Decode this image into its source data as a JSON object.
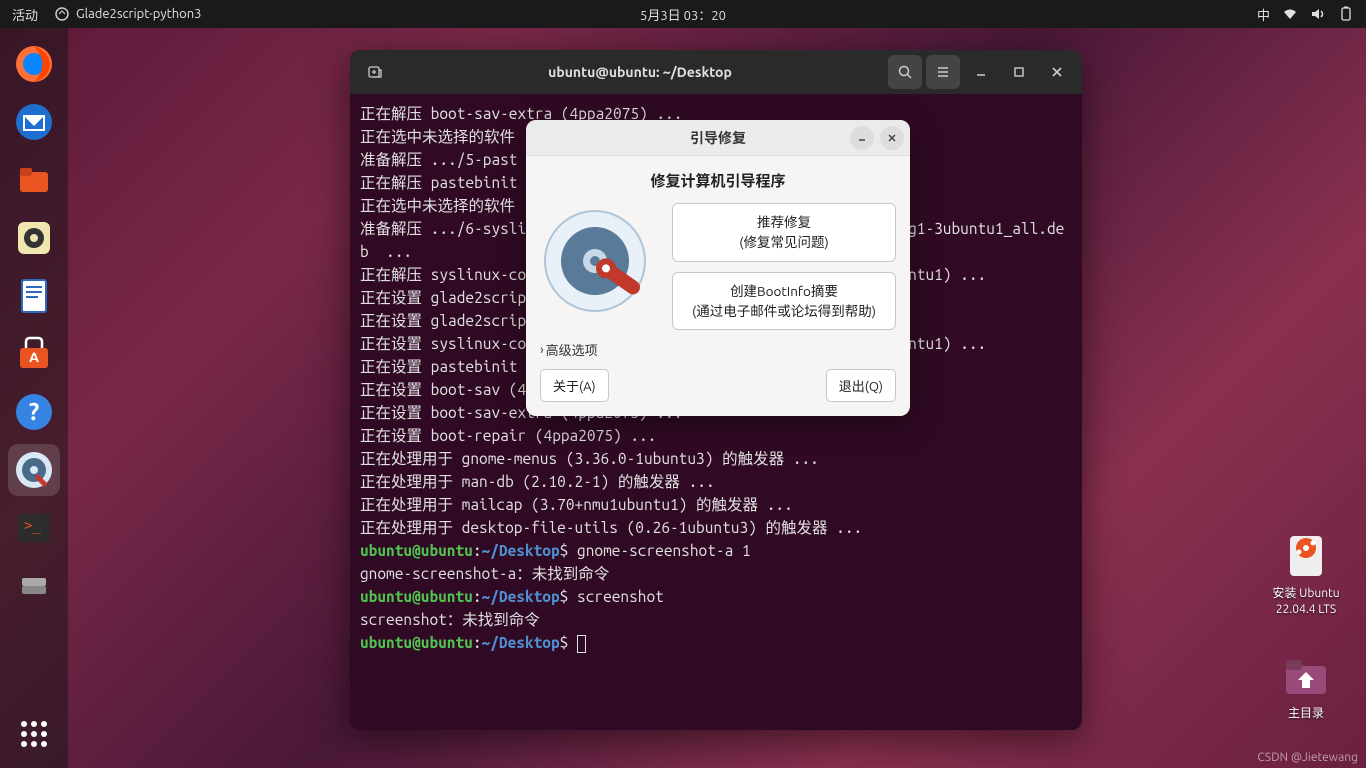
{
  "topbar": {
    "activities": "活动",
    "app_name": "Glade2script-python3",
    "datetime": "5月3日 03：20",
    "input_method": "中"
  },
  "terminal": {
    "title": "ubuntu@ubuntu: ~/Desktop",
    "lines": [
      "正在解压 boot-sav-extra (4ppa2075) ...",
      "正在选中未选择的软件",
      "准备解压 .../5-past",
      "正在解压 pastebinit",
      "正在选中未选择的软件",
      "准备解压 .../6-syslinux-common_3%3a6.04~git20190206.bf6db5b4+dfsg1-3ubuntu1_all.deb  ...",
      "正在解压 syslinux-common (3:6.04~git20190206.bf6db5b4+dfsg1-3ubuntu1) ...",
      "正在设置 glade2script",
      "正在设置 glade2script",
      "正在设置 syslinux-common (3:6.04~git20190206.bf6db5b4+dfsg1-3ubuntu1) ...",
      "正在设置 pastebinit",
      "正在设置 boot-sav (4ppa2075) ...",
      "正在设置 boot-sav-extra (4ppa2075) ...",
      "正在设置 boot-repair (4ppa2075) ...",
      "正在处理用于 gnome-menus (3.36.0-1ubuntu3) 的触发器 ...",
      "正在处理用于 man-db (2.10.2-1) 的触发器 ...",
      "正在处理用于 mailcap (3.70+nmu1ubuntu1) 的触发器 ...",
      "正在处理用于 desktop-file-utils (0.26-1ubuntu3) 的触发器 ..."
    ],
    "prompts": [
      {
        "user": "ubuntu@ubuntu",
        "path": "~/Desktop",
        "cmd": "gnome-screenshot-a 1"
      },
      {
        "plain": "gnome-screenshot-a：未找到命令"
      },
      {
        "user": "ubuntu@ubuntu",
        "path": "~/Desktop",
        "cmd": "screenshot"
      },
      {
        "plain": "screenshot：未找到命令"
      },
      {
        "user": "ubuntu@ubuntu",
        "path": "~/Desktop",
        "cmd": ""
      }
    ]
  },
  "modal": {
    "title": "引导修复",
    "heading": "修复计算机引导程序",
    "btn1_line1": "推荐修复",
    "btn1_line2": "(修复常见问题)",
    "btn2_line1": "创建BootInfo摘要",
    "btn2_line2": "(通过电子邮件或论坛得到帮助)",
    "advanced": "高级选项",
    "about": "关于(A)",
    "quit": "退出(Q)"
  },
  "desktop": {
    "install_line1": "安装 Ubuntu",
    "install_line2": "22.04.4 LTS",
    "home": "主目录"
  },
  "watermark": "CSDN @Jietewang",
  "colors": {
    "terminal_bg": "#300a24",
    "prompt_green": "#4fc24f",
    "prompt_blue": "#4f8fcf"
  }
}
